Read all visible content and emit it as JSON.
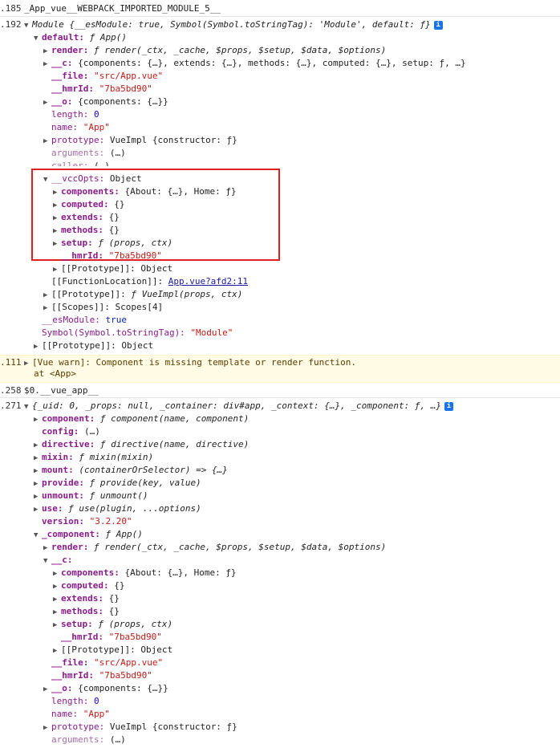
{
  "colors": {
    "highlight_box": "#e02020",
    "warning_bg": "#fffbe5",
    "info_badge": "#1a73e8"
  },
  "icons": {
    "expand": "triangle-right-icon",
    "collapse": "triangle-down-icon",
    "info": "info-icon"
  },
  "block1": {
    "l1": {
      "prefix": ".185",
      "text": "_App_vue__WEBPACK_IMPORTED_MODULE_5__"
    },
    "l2": {
      "prefix": ".192",
      "text": "Module {__esModule: true, Symbol(Symbol.toStringTag): 'Module', default: ƒ}",
      "info": "i"
    },
    "l3": {
      "key": "default:",
      "val": "ƒ App()"
    },
    "l4": {
      "key": "render:",
      "val": "ƒ render(_ctx, _cache, $props, $setup, $data, $options)"
    },
    "l5": {
      "key": "__c:",
      "val": "{components: {…}, extends: {…}, methods: {…}, computed: {…}, setup: ƒ, …}"
    },
    "l6": {
      "key": "__file:",
      "val": "\"src/App.vue\""
    },
    "l7": {
      "key": "__hmrId:",
      "val": "\"7ba5bd90\""
    },
    "l8": {
      "key": "__o:",
      "val": "{components: {…}}"
    },
    "l9": {
      "key": "length:",
      "val": "0"
    },
    "l10": {
      "key": "name:",
      "val": "\"App\""
    },
    "l11": {
      "key": "prototype:",
      "val": "VueImpl {constructor: ƒ}"
    },
    "l12": {
      "key": "arguments:",
      "val": "(…)"
    },
    "l13": {
      "key": "caller:",
      "val": "(…)"
    },
    "l14": {
      "key": "__vccOpts:",
      "val": "Object"
    },
    "l15": {
      "key": "components:",
      "val": "{About: {…}, Home: ƒ}"
    },
    "l16": {
      "key": "computed:",
      "val": "{}"
    },
    "l17": {
      "key": "extends:",
      "val": "{}"
    },
    "l18": {
      "key": "methods:",
      "val": "{}"
    },
    "l19": {
      "key": "setup:",
      "val": "ƒ (props, ctx)"
    },
    "l20": {
      "key": "__hmrId:",
      "val": "\"7ba5bd90\""
    },
    "l21": {
      "key": "[[Prototype]]:",
      "val": "Object"
    },
    "l22": {
      "key": "[[FunctionLocation]]:",
      "val": "App.vue?afd2:11"
    },
    "l23": {
      "key": "[[Prototype]]:",
      "val": "ƒ VueImpl(props, ctx)"
    },
    "l24": {
      "key": "[[Scopes]]:",
      "val": "Scopes[4]"
    },
    "l25": {
      "key": "__esModule:",
      "val": "true"
    },
    "l26": {
      "key": "Symbol(Symbol.toStringTag):",
      "val": "\"Module\""
    },
    "l27": {
      "key": "[[Prototype]]:",
      "val": "Object"
    }
  },
  "warning": {
    "prefix": ".111",
    "text": "[Vue warn]: Component is missing template or render function.",
    "at": "at <App>"
  },
  "block2": {
    "l1": {
      "prefix": ".258",
      "text": "$0.__vue_app__"
    },
    "l2": {
      "prefix": ".271",
      "text": "{_uid: 0, _props: null, _container: div#app, _context: {…}, _component: ƒ, …}",
      "info": "i"
    },
    "l3": {
      "key": "component:",
      "val": "ƒ component(name, component)"
    },
    "l4": {
      "key": "config:",
      "val": "(…)"
    },
    "l5": {
      "key": "directive:",
      "val": "ƒ directive(name, directive)"
    },
    "l6": {
      "key": "mixin:",
      "val": "ƒ mixin(mixin)"
    },
    "l7": {
      "key": "mount:",
      "val": "(containerOrSelector) => {…}"
    },
    "l8": {
      "key": "provide:",
      "val": "ƒ provide(key, value)"
    },
    "l9": {
      "key": "unmount:",
      "val": "ƒ unmount()"
    },
    "l10": {
      "key": "use:",
      "val": "ƒ use(plugin, ...options)"
    },
    "l11": {
      "key": "version:",
      "val": "\"3.2.20\""
    },
    "l12": {
      "key": "_component:",
      "val": "ƒ App()"
    },
    "l13": {
      "key": "render:",
      "val": "ƒ render(_ctx, _cache, $props, $setup, $data, $options)"
    },
    "l14": {
      "key": "__c:",
      "val": ""
    },
    "l15": {
      "key": "components:",
      "val": "{About: {…}, Home: ƒ}"
    },
    "l16": {
      "key": "computed:",
      "val": "{}"
    },
    "l17": {
      "key": "extends:",
      "val": "{}"
    },
    "l18": {
      "key": "methods:",
      "val": "{}"
    },
    "l19": {
      "key": "setup:",
      "val": "ƒ (props, ctx)"
    },
    "l20": {
      "key": "__hmrId:",
      "val": "\"7ba5bd90\""
    },
    "l21": {
      "key": "[[Prototype]]:",
      "val": "Object"
    },
    "l22": {
      "key": "__file:",
      "val": "\"src/App.vue\""
    },
    "l23": {
      "key": "__hmrId:",
      "val": "\"7ba5bd90\""
    },
    "l24": {
      "key": "__o:",
      "val": "{components: {…}}"
    },
    "l25": {
      "key": "length:",
      "val": "0"
    },
    "l26": {
      "key": "name:",
      "val": "\"App\""
    },
    "l27": {
      "key": "prototype:",
      "val": "VueImpl {constructor: ƒ}"
    },
    "l28": {
      "key": "arguments:",
      "val": "(…)"
    }
  }
}
